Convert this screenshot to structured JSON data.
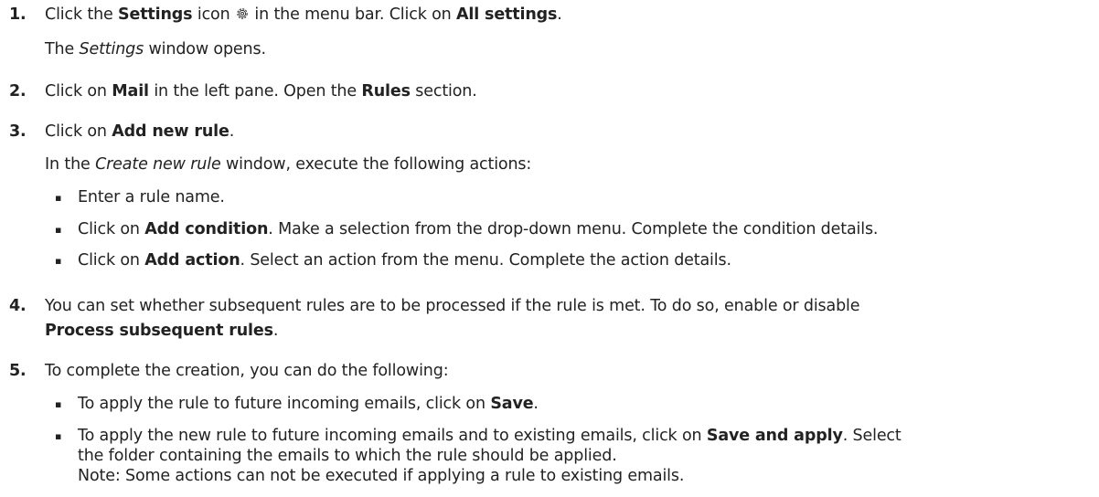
{
  "steps": [
    {
      "num": "1.",
      "s1a": "Click the ",
      "s1b": "Settings",
      "s1c": " icon ",
      "s1d": " in the menu bar. Click on ",
      "s1e": "All settings",
      "s1f": ".",
      "note_a": "The ",
      "note_b": "Settings",
      "note_c": " window opens."
    },
    {
      "num": "2.",
      "a": "Click on ",
      "b": "Mail",
      "c": " in the left pane. Open the ",
      "d": "Rules",
      "e": " section."
    },
    {
      "num": "3.",
      "a": "Click on ",
      "b": "Add new rule",
      "c": ".",
      "note_a": "In the ",
      "note_b": "Create new rule",
      "note_c": " window, execute the following actions:",
      "bullets": {
        "b1": "Enter a rule name.",
        "b2a": "Click on ",
        "b2b": "Add condition",
        "b2c": ". Make a selection from the drop-down menu. Complete the condition details.",
        "b3a": "Click on ",
        "b3b": "Add action",
        "b3c": ". Select an action from the menu. Complete the action details."
      }
    },
    {
      "num": "4.",
      "l1": "You can set whether subsequent rules are to be processed if the rule is met. To do so, enable or disable",
      "l2a": "Process subsequent rules",
      "l2b": "."
    },
    {
      "num": "5.",
      "a": "To complete the creation, you can do the following:",
      "bullets": {
        "b1a": "To apply the rule to future incoming emails, click on ",
        "b1b": "Save",
        "b1c": ".",
        "b2a": "To apply the new rule to future incoming emails and to existing emails, click on ",
        "b2b": "Save and apply",
        "b2c": ". Select",
        "b2d": "the folder containing the emails to which the rule should be applied.",
        "b2e": "Note: Some actions can not be executed if applying a rule to existing emails."
      }
    }
  ],
  "bullet_glyph": "▪",
  "icon": "gear-icon"
}
